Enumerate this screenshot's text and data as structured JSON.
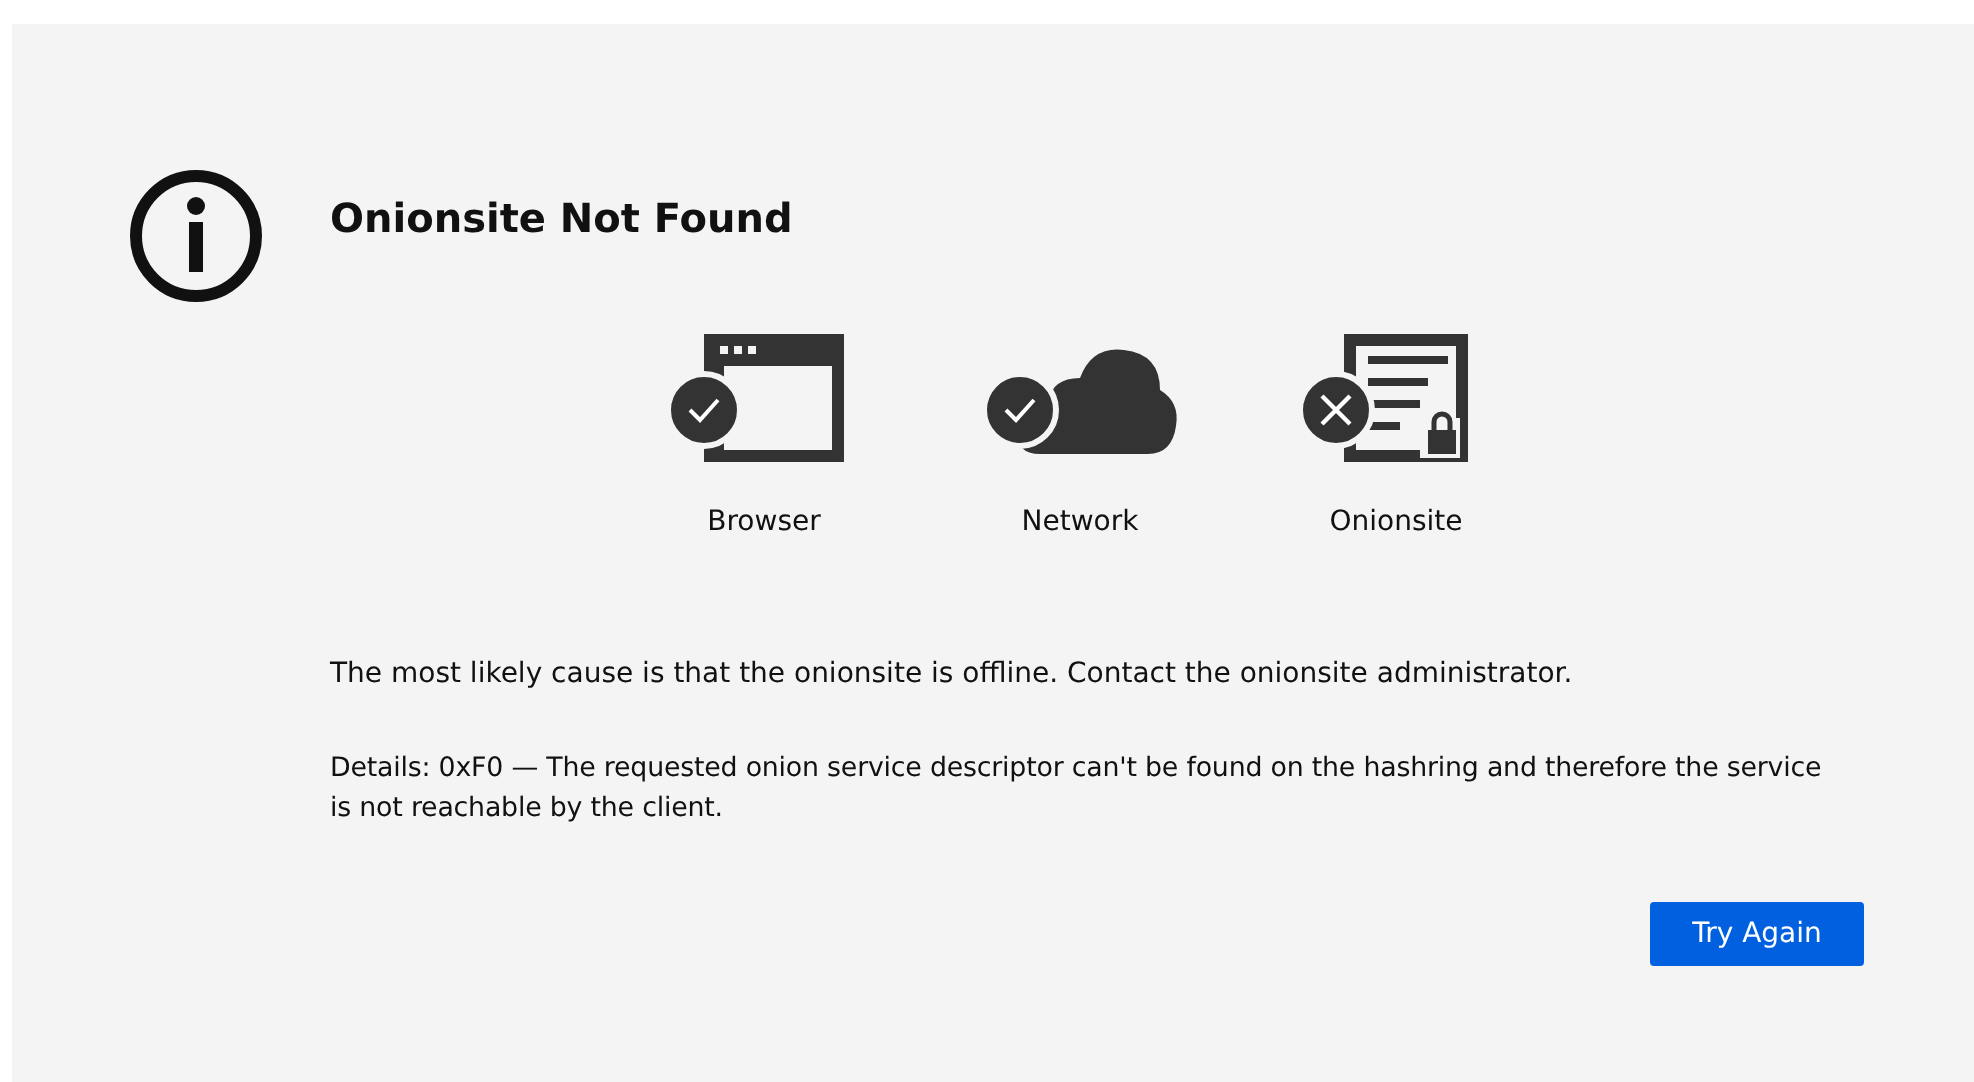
{
  "title": "Onionsite Not Found",
  "checks": [
    {
      "kind": "browser",
      "label": "Browser",
      "passed": true
    },
    {
      "kind": "network",
      "label": "Network",
      "passed": true
    },
    {
      "kind": "onionsite",
      "label": "Onionsite",
      "passed": false
    }
  ],
  "cause": "The most likely cause is that the onionsite is offline. Contact the onionsite administrator.",
  "details": "Details: 0xF0 — The requested onion service descriptor can't be found on the hashring and therefore the service is not reachable by the client.",
  "button": "Try Again"
}
